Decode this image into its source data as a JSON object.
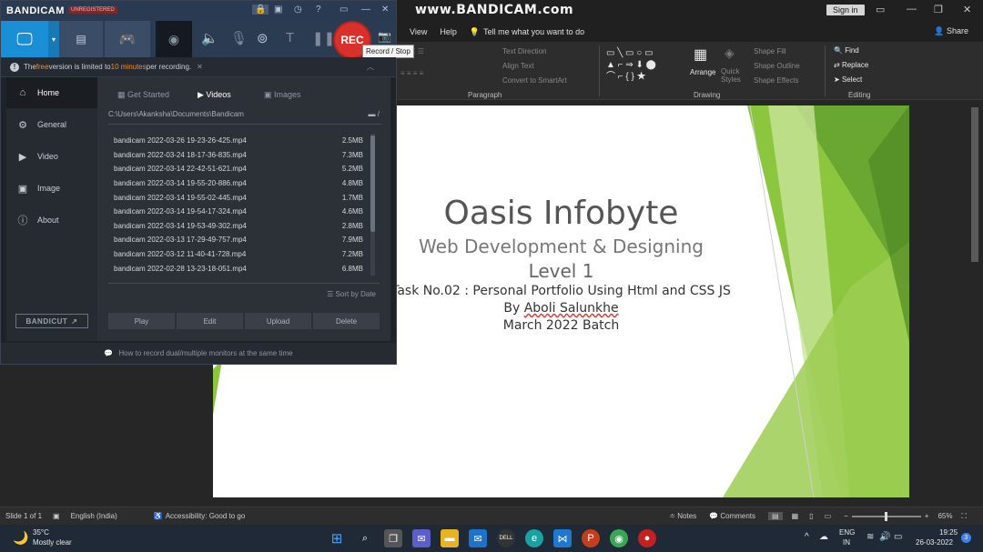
{
  "watermark": "www.BANDICAM.com",
  "ppt": {
    "sign_in": "Sign in",
    "menu": [
      "View",
      "Help"
    ],
    "tell_me": "Tell me what you want to do",
    "share": "Share",
    "ribbon": {
      "paragraph_label": "Paragraph",
      "drawing_label": "Drawing",
      "editing_label": "Editing",
      "text_direction": "Text Direction",
      "align_text": "Align Text",
      "convert_smartart": "Convert to SmartArt",
      "arrange": "Arrange",
      "quick_styles": "Quick Styles",
      "shape_fill": "Shape Fill",
      "shape_outline": "Shape Outline",
      "shape_effects": "Shape Effects",
      "find": "Find",
      "replace": "Replace",
      "select": "Select"
    },
    "slide": {
      "title": "Oasis Infobyte",
      "subtitle": "Web Development & Designing",
      "level": "Level 1",
      "task": "Task No.02 : Personal Portfolio Using Html and CSS JS",
      "by_prefix": "By",
      "author": "Aboli Salunkhe",
      "batch": "March 2022 Batch"
    },
    "status": {
      "slide": "Slide 1 of 1",
      "language": "English (India)",
      "accessibility": "Accessibility: Good to go",
      "notes": "Notes",
      "comments": "Comments",
      "zoom": "65%"
    }
  },
  "bandicam": {
    "logo": "BANDICAM",
    "unregistered": "UNREGISTERED",
    "rec_label": "REC",
    "tooltip": "Record / Stop",
    "notice_pre": "The ",
    "notice_free": "free",
    "notice_mid": " version is limited to ",
    "notice_limit": "10 minutes",
    "notice_post": " per recording.",
    "sidebar": [
      "Home",
      "General",
      "Video",
      "Image",
      "About"
    ],
    "bandicut": "BANDICUT",
    "tabs": [
      "Get Started",
      "Videos",
      "Images"
    ],
    "path": "C:\\Users\\Akanksha\\Documents\\Bandicam",
    "files": [
      {
        "name": "bandicam 2022-03-26 19-23-26-425.mp4",
        "size": "2.5MB"
      },
      {
        "name": "bandicam 2022-03-24 18-17-36-835.mp4",
        "size": "7.3MB"
      },
      {
        "name": "bandicam 2022-03-14 22-42-51-621.mp4",
        "size": "5.2MB"
      },
      {
        "name": "bandicam 2022-03-14 19-55-20-886.mp4",
        "size": "4.8MB"
      },
      {
        "name": "bandicam 2022-03-14 19-55-02-445.mp4",
        "size": "1.7MB"
      },
      {
        "name": "bandicam 2022-03-14 19-54-17-324.mp4",
        "size": "4.6MB"
      },
      {
        "name": "bandicam 2022-03-14 19-53-49-302.mp4",
        "size": "2.8MB"
      },
      {
        "name": "bandicam 2022-03-13 17-29-49-757.mp4",
        "size": "7.9MB"
      },
      {
        "name": "bandicam 2022-03-12 11-40-41-728.mp4",
        "size": "7.2MB"
      },
      {
        "name": "bandicam 2022-02-28 13-23-18-051.mp4",
        "size": "6.8MB"
      }
    ],
    "sort_label": "Sort by Date",
    "actions": [
      "Play",
      "Edit",
      "Upload",
      "Delete"
    ],
    "footer": "How to record dual/multiple monitors at the same time"
  },
  "taskbar": {
    "weather_temp": "35°C",
    "weather_desc": "Mostly clear",
    "lang_top": "ENG",
    "lang_bottom": "IN",
    "time": "19:25",
    "date": "26-03-2022",
    "notif_count": "3"
  },
  "colors": {
    "accent_blue": "#1b8fd6",
    "rec_red": "#d8302a",
    "notice_orange": "#f08a24",
    "slide_green": "#8cc63f"
  }
}
